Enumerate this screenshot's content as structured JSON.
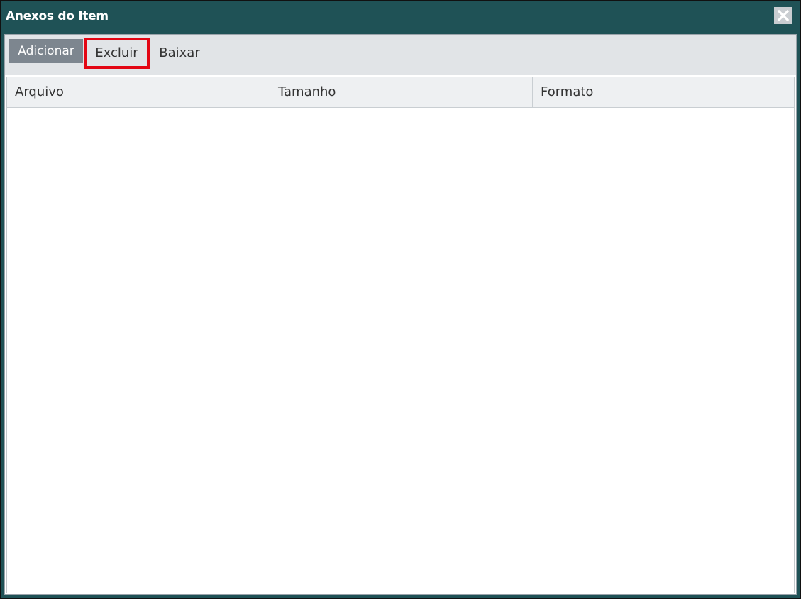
{
  "dialog": {
    "title": "Anexos do Item",
    "close_icon": "close-icon"
  },
  "toolbar": {
    "buttons": [
      {
        "label": "Adicionar",
        "state": "active"
      },
      {
        "label": "Excluir",
        "state": "highlighted"
      },
      {
        "label": "Baixar",
        "state": "normal"
      }
    ]
  },
  "grid": {
    "columns": [
      "Arquivo",
      "Tamanho",
      "Formato"
    ],
    "rows": []
  },
  "colors": {
    "titlebar": "#1f5256",
    "toolbar": "#e1e4e7",
    "active_button": "#7d868f",
    "highlight": "#e30613"
  }
}
